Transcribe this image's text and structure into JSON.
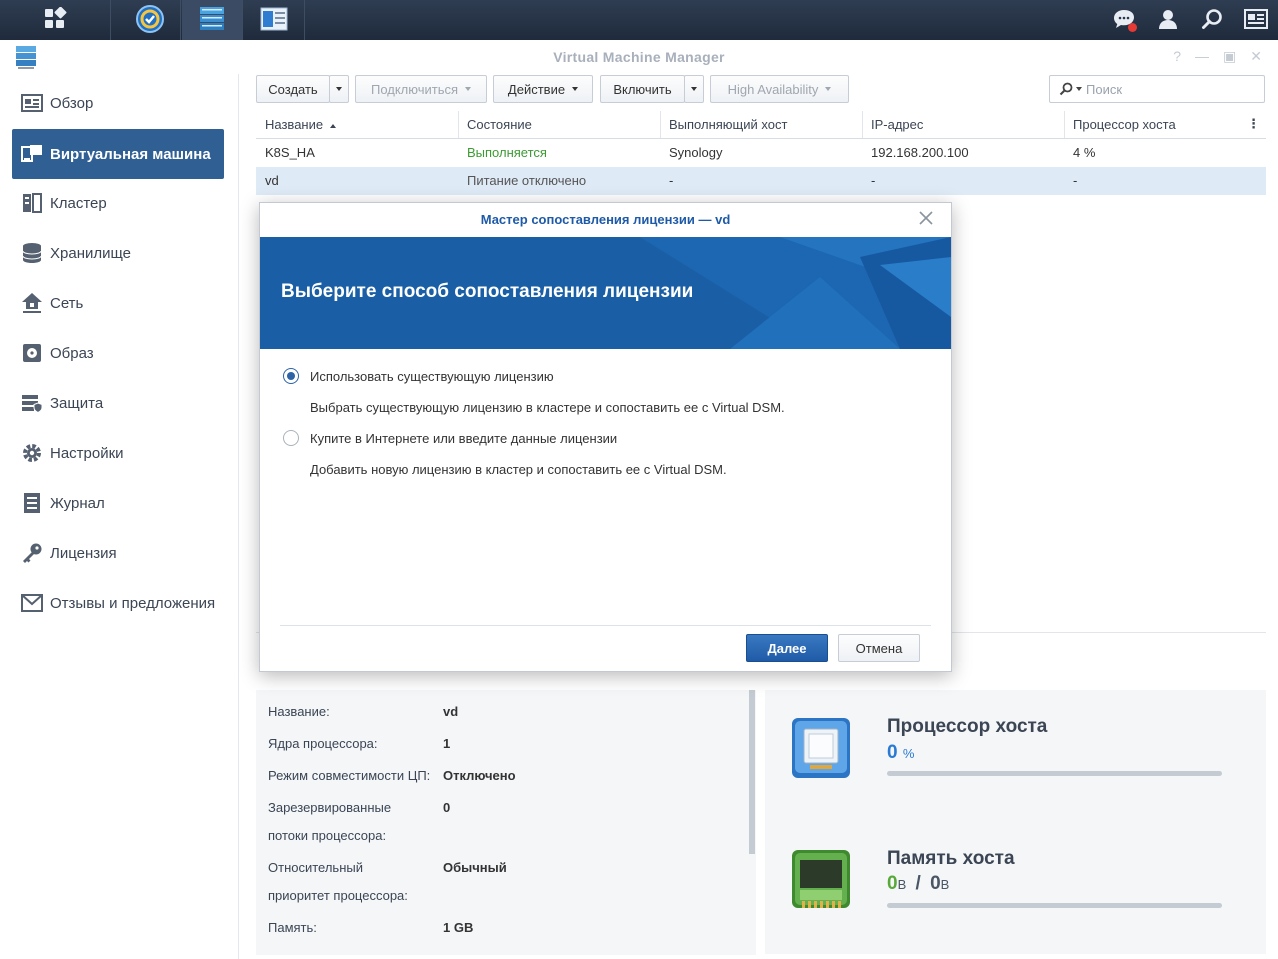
{
  "app": {
    "title": "Virtual Machine Manager"
  },
  "sidebar": {
    "items": [
      {
        "label": "Обзор",
        "icon": "overview-icon"
      },
      {
        "label": "Виртуальная машина",
        "icon": "virtual-machine-icon",
        "active": true
      },
      {
        "label": "Кластер",
        "icon": "cluster-icon"
      },
      {
        "label": "Хранилище",
        "icon": "storage-icon"
      },
      {
        "label": "Сеть",
        "icon": "network-icon"
      },
      {
        "label": "Образ",
        "icon": "image-icon"
      },
      {
        "label": "Защита",
        "icon": "protection-icon"
      },
      {
        "label": "Настройки",
        "icon": "settings-icon"
      },
      {
        "label": "Журнал",
        "icon": "log-icon"
      },
      {
        "label": "Лицензия",
        "icon": "license-key-icon"
      },
      {
        "label": "Отзывы и предложения",
        "icon": "feedback-icon"
      }
    ]
  },
  "toolbar": {
    "create": "Создать",
    "connect": "Подключиться",
    "action": "Действие",
    "power_on": "Включить",
    "high_availability": "High Availability",
    "search_placeholder": "Поиск"
  },
  "table": {
    "columns": [
      "Название",
      "Состояние",
      "Выполняющий хост",
      "IP-адрес",
      "Процессор хоста"
    ],
    "rows": [
      {
        "name": "K8S_HA",
        "status": "Выполняется",
        "host": "Synology",
        "ip": "192.168.200.100",
        "cpu": "4 %"
      },
      {
        "name": "vd",
        "status": "Питание отключено",
        "host": "-",
        "ip": "-",
        "cpu": "-"
      }
    ]
  },
  "details": {
    "name_label": "Название:",
    "name_value": "vd",
    "cores_label": "Ядра процессора:",
    "cores_value": "1",
    "compat_label": "Режим совместимости ЦП:",
    "compat_value": "Отключено",
    "reserved_label_1": "Зарезервированные",
    "reserved_label_2": "потоки процессора:",
    "reserved_value": "0",
    "priority_label_1": "Относительный",
    "priority_label_2": "приоритет процессора:",
    "priority_value": "Обычный",
    "memory_label": "Память:",
    "memory_value": "1 GB"
  },
  "resources": {
    "cpu_title": "Процессор хоста",
    "cpu_value": "0",
    "cpu_unit": "%",
    "mem_title": "Память хоста",
    "mem_used": "0",
    "mem_used_unit": "B",
    "mem_sep": "/",
    "mem_total": "0",
    "mem_total_unit": "B"
  },
  "dialog": {
    "title": "Мастер сопоставления лицензии — vd",
    "heading": "Выберите способ сопоставления лицензии",
    "option1_label": "Использовать существующую лицензию",
    "option1_desc": "Выбрать существующую лицензию в кластере и сопоставить ее с Virtual DSM.",
    "option2_label": "Купите в Интернете или введите данные лицензии",
    "option2_desc": "Добавить новую лицензию в кластер и сопоставить ее с Virtual DSM.",
    "selected_option": 1,
    "next": "Далее",
    "cancel": "Отмена"
  },
  "colors": {
    "accent": "#305f94",
    "banner": "#1a5fa6",
    "running": "#3c9a32",
    "selected_row": "#dfeaf7"
  }
}
